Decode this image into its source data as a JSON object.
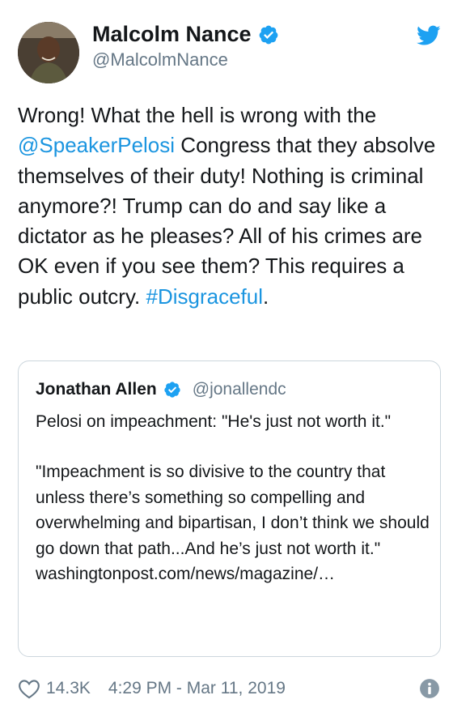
{
  "author": {
    "display_name": "Malcolm Nance",
    "handle": "@MalcolmNance",
    "verified": true
  },
  "tweet": {
    "text_parts": [
      {
        "text": "Wrong! What the hell is wrong with the ",
        "type": "plain"
      },
      {
        "text": "@SpeakerPelosi",
        "type": "mention"
      },
      {
        "text": " Congress that they absolve themselves of their duty! Nothing is criminal anymore?! Trump can do and say like a dictator as he pleases? All of his crimes are OK even if you see them? This requires a public outcry. ",
        "type": "plain"
      },
      {
        "text": "#Disgraceful",
        "type": "hashtag"
      },
      {
        "text": ".",
        "type": "plain"
      }
    ]
  },
  "quoted_tweet": {
    "display_name": "Jonathan Allen",
    "handle": "@jonallendc",
    "verified": true,
    "line1": "Pelosi on impeachment: \"He's just not worth it.\"",
    "line2": "\"Impeachment is so divisive to the country that unless there’s something so compelling and overwhelming and bipartisan, I don’t think we should go down that path...And he’s just not worth it.\"",
    "link": "washingtonpost.com/news/magazine/…"
  },
  "footer": {
    "likes": "14.3K",
    "timestamp": "4:29 PM - Mar 11, 2019",
    "icons": [
      "heart-icon",
      "info-icon"
    ]
  },
  "colors": {
    "link": "#1b95e0",
    "verified": "#1da1f2",
    "secondary_text": "#657786",
    "border": "#ccd6dd"
  }
}
